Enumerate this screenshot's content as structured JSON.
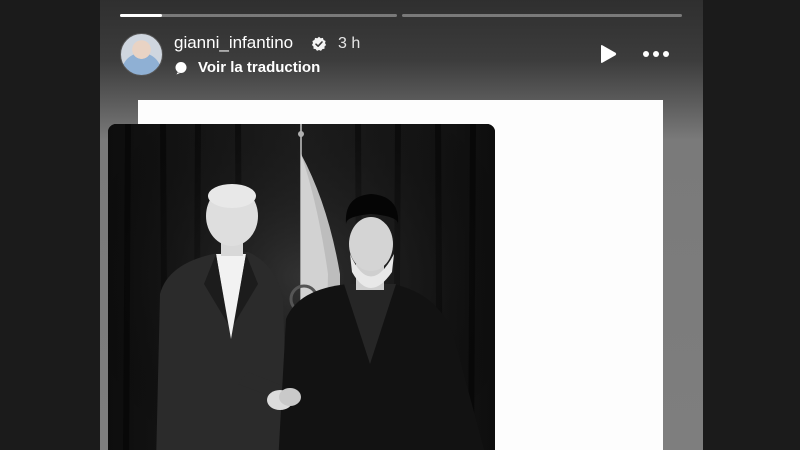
{
  "story": {
    "progress": [
      0.15,
      0.0
    ],
    "user": {
      "username": "gianni_infantino",
      "verified": true,
      "time_ago": "3 h"
    },
    "translate_label": "Voir la traduction",
    "controls": {
      "play_icon": "play-icon",
      "more_icon": "more-icon"
    },
    "colors": {
      "background": "#7e7e7e",
      "frame": "#fdfdfd",
      "text": "#ffffff"
    }
  }
}
